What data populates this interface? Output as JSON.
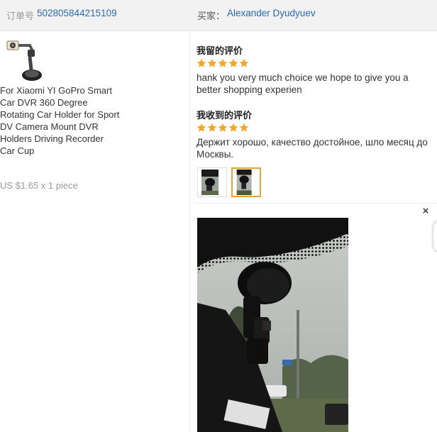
{
  "header": {
    "order_label": "订单号",
    "order_number": "502805844215109",
    "buyer_label": "买家：",
    "buyer_name": "Alexander Dyudyuev"
  },
  "product": {
    "title": "For Xiaomi YI GoPro Smart Car DVR 360 Degree Rotating Car Holder for Sport DV Camera Mount DVR Holders Driving Recorder Car Cup",
    "price": "US $1.65 x 1 piece"
  },
  "my_review": {
    "title": "我留的评价",
    "rating": 5,
    "text": "hank you very much choice we hope to give you a better shopping experien"
  },
  "received_review": {
    "title": "我收到的评价",
    "rating": 5,
    "text": "Держит хорошо, качество достойное, шло месяц до Москвы."
  },
  "viewer": {
    "close_symbol": "×"
  },
  "colors": {
    "link": "#2a6ab8",
    "star": "#f5a623",
    "active_thumb_border": "#e8a33a"
  }
}
